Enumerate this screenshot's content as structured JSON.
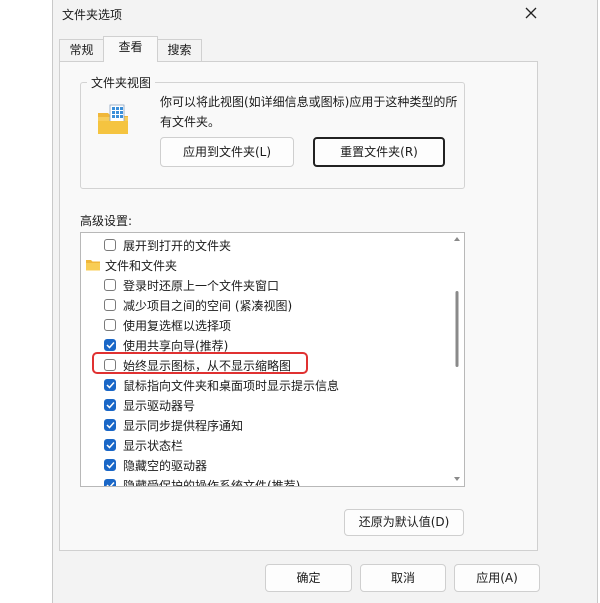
{
  "window": {
    "title": "文件夹选项",
    "close_icon": "close-icon"
  },
  "tabs": [
    {
      "label": "常规",
      "active": false
    },
    {
      "label": "查看",
      "active": true
    },
    {
      "label": "搜索",
      "active": false
    }
  ],
  "folder_view": {
    "title": "文件夹视图",
    "description": "你可以将此视图(如详细信息或图标)应用于这种类型的所有文件夹。",
    "apply_button": "应用到文件夹(L)",
    "reset_button": "重置文件夹(R)"
  },
  "advanced": {
    "label": "高级设置:",
    "items": [
      {
        "kind": "checkbox",
        "label": "展开到打开的文件夹",
        "checked": false,
        "indent": 1
      },
      {
        "kind": "folder",
        "label": "文件和文件夹",
        "icon": "folder-icon",
        "indent": 0
      },
      {
        "kind": "checkbox",
        "label": "登录时还原上一个文件夹窗口",
        "checked": false,
        "indent": 1
      },
      {
        "kind": "checkbox",
        "label": "减少项目之间的空间 (紧凑视图)",
        "checked": false,
        "indent": 1
      },
      {
        "kind": "checkbox",
        "label": "使用复选框以选择项",
        "checked": false,
        "indent": 1
      },
      {
        "kind": "checkbox",
        "label": "使用共享向导(推荐)",
        "checked": true,
        "indent": 1
      },
      {
        "kind": "checkbox",
        "label": "始终显示图标，从不显示缩略图",
        "checked": false,
        "indent": 1
      },
      {
        "kind": "checkbox",
        "label": "鼠标指向文件夹和桌面项时显示提示信息",
        "checked": true,
        "indent": 1
      },
      {
        "kind": "checkbox",
        "label": "显示驱动器号",
        "checked": true,
        "indent": 1
      },
      {
        "kind": "checkbox",
        "label": "显示同步提供程序通知",
        "checked": true,
        "indent": 1
      },
      {
        "kind": "checkbox",
        "label": "显示状态栏",
        "checked": true,
        "indent": 1
      },
      {
        "kind": "checkbox",
        "label": "隐藏空的驱动器",
        "checked": true,
        "indent": 1
      },
      {
        "kind": "checkbox",
        "label": "隐藏受保护的操作系统文件(推荐)",
        "checked": true,
        "indent": 1
      }
    ],
    "restore_button": "还原为默认值(D)"
  },
  "footer": {
    "ok": "确定",
    "cancel": "取消",
    "apply": "应用(A)"
  },
  "colors": {
    "accent": "#1a67c7",
    "highlight": "#e03131"
  }
}
